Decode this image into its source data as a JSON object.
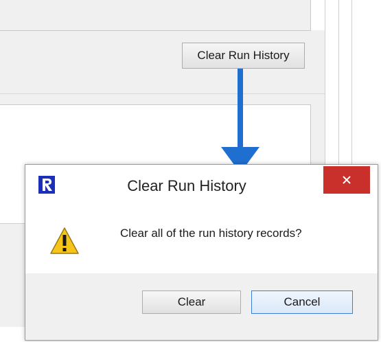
{
  "background": {
    "clear_history_button_label": "Clear Run History"
  },
  "dialog": {
    "title": "Clear Run History",
    "message": "Clear all of the run history records?",
    "buttons": {
      "clear": "Clear",
      "cancel": "Cancel"
    },
    "icons": {
      "app": "riverware-r-icon",
      "message": "warning-icon",
      "close": "close-icon"
    }
  },
  "colors": {
    "arrow": "#1e6fd0",
    "close_button": "#c9302c",
    "default_button_border": "#3c7fd6"
  }
}
